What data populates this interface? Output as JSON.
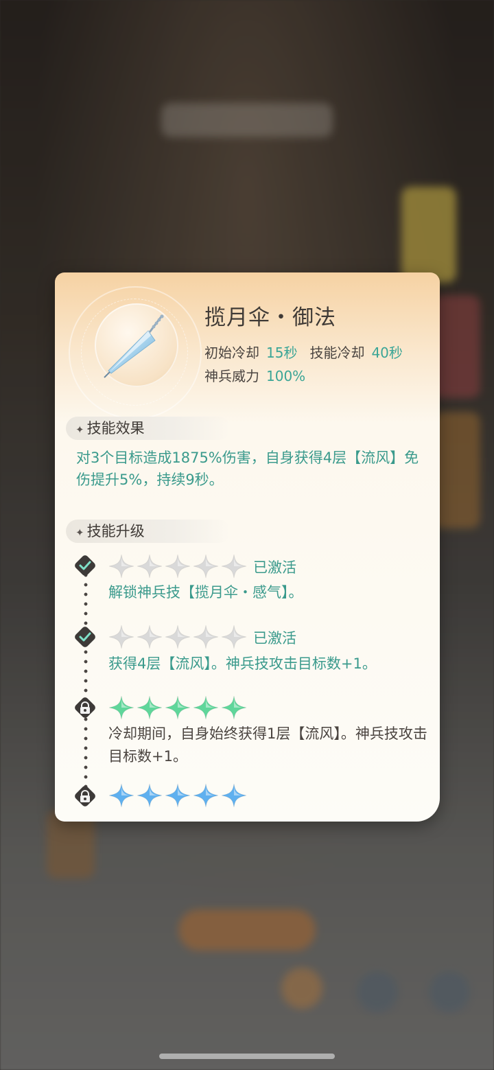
{
  "dialog": {
    "title": "揽月伞・御法",
    "stats": {
      "initial_cd_label": "初始冷却",
      "initial_cd_value": "15秒",
      "skill_cd_label": "技能冷却",
      "skill_cd_value": "40秒",
      "power_label": "神兵威力",
      "power_value": "100%"
    },
    "effect_section": {
      "header": "技能效果",
      "text": "对3个目标造成1875%伤害，自身获得4层【流风】免伤提升5%，持续9秒。"
    },
    "upgrade_section": {
      "header": "技能升级",
      "levels": [
        {
          "stars": 5,
          "star_color": "#d9d9d9",
          "status": "已激活",
          "node": "check-icon",
          "text": "解锁神兵技【揽月伞・感气】。"
        },
        {
          "stars": 5,
          "star_color": "#d9d9d9",
          "status": "已激活",
          "node": "check-icon",
          "text": "获得4层【流风】。神兵技攻击目标数+1。"
        },
        {
          "stars": 5,
          "star_color": "#5fd69a",
          "status": "",
          "node": "lock-icon",
          "text": "冷却期间，自身始终获得1层【流风】。神兵技攻击目标数+1。"
        },
        {
          "stars": 5,
          "star_color": "#5fb0ef",
          "status": "",
          "node": "lock-icon",
          "text": ""
        }
      ]
    }
  },
  "colors": {
    "accent_teal": "#3a9a8c",
    "card_top": "#f6d2a3",
    "card_bottom": "#fdfcf7"
  }
}
